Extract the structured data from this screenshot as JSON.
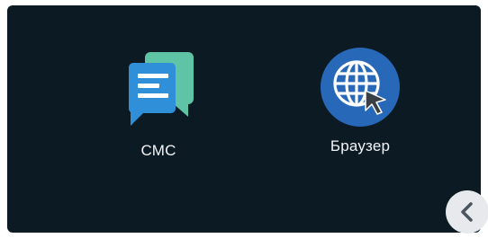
{
  "apps": [
    {
      "label": "СМС",
      "icon": "sms-chat-icon",
      "colors": {
        "front": "#2f8fd8",
        "back": "#5fc4a6"
      }
    },
    {
      "label": "Браузер",
      "icon": "globe-cursor-icon",
      "colors": {
        "circle": "#2868b8",
        "globe": "#ffffff"
      }
    }
  ],
  "nav": {
    "back_icon": "chevron-left-icon"
  },
  "theme": {
    "background": "#0c1a24",
    "label": "#f2f4f6"
  }
}
